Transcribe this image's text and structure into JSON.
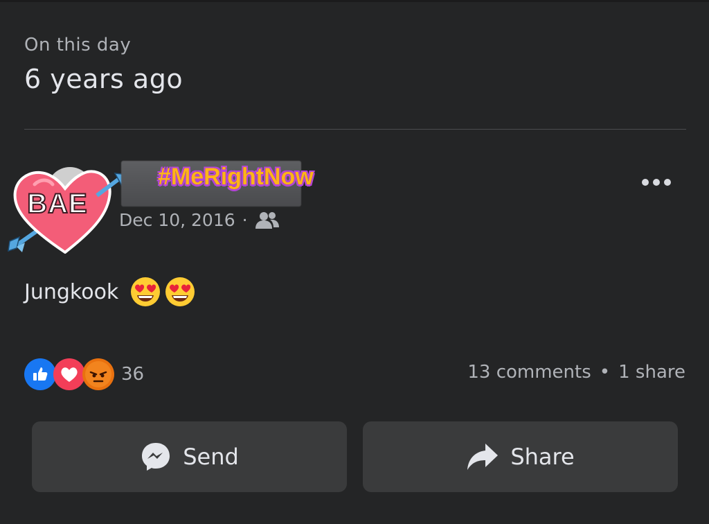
{
  "header": {
    "subtitle": "On this day",
    "title": "6 years ago"
  },
  "post": {
    "sticker_text": "BAE",
    "hashtag_sticker": "#MeRightNow",
    "date": "Dec 10, 2016",
    "separator": "·",
    "audience_icon": "friends-icon",
    "text": "Jungkook",
    "emojis": [
      "heart-eyes-emoji",
      "heart-eyes-emoji"
    ]
  },
  "reactions": {
    "types": [
      "like",
      "love",
      "angry"
    ],
    "count": "36"
  },
  "stats": {
    "comments": "13 comments",
    "dot": "•",
    "shares": "1 share"
  },
  "actions": {
    "send_label": "Send",
    "share_label": "Share"
  },
  "colors": {
    "background": "#242526",
    "button": "#3a3b3c",
    "text_primary": "#e4e6eb",
    "text_secondary": "#b0b3b8",
    "like_blue": "#1877f2",
    "love_red": "#f33e58",
    "angry_orange": "#e9710f"
  }
}
